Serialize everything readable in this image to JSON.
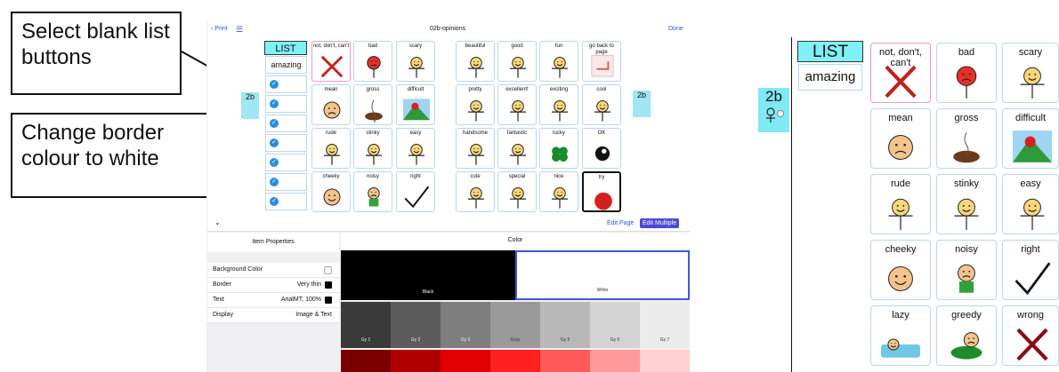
{
  "callouts": {
    "select_blank": "Select blank list buttons",
    "change_border": "Change border colour to white"
  },
  "ipad": {
    "print_label": "Print",
    "title": "02b-opinions",
    "done_label": "Done",
    "list_header": "LIST",
    "list_first": "amazing",
    "side_label": "2b",
    "edit_page": "Edit Page",
    "edit_multiple": "Edit Multiple",
    "item_properties": "Item Properties",
    "color_header": "Color",
    "properties": [
      {
        "key": "Background Color",
        "value": ""
      },
      {
        "key": "Border",
        "value": "Very thin"
      },
      {
        "key": "Text",
        "value": "ArialMT, 100%"
      },
      {
        "key": "Display",
        "value": "Image & Text"
      }
    ],
    "swatches_top": [
      {
        "name": "Black",
        "color": "#000000"
      },
      {
        "name": "White",
        "color": "#ffffff"
      }
    ],
    "swatches_gray": [
      {
        "name": "Gy 1",
        "color": "#3a3a3a"
      },
      {
        "name": "Gy 2",
        "color": "#5c5c5c"
      },
      {
        "name": "Gy 3",
        "color": "#7e7e7e"
      },
      {
        "name": "Gray",
        "color": "#9a9a9a"
      },
      {
        "name": "Gy 5",
        "color": "#b8b8b8"
      },
      {
        "name": "Gy 6",
        "color": "#d4d4d4"
      },
      {
        "name": "Gy 7",
        "color": "#ececec"
      }
    ],
    "swatches_red": [
      "#7a0000",
      "#b00000",
      "#e00000",
      "#ff2020",
      "#ff5a5a",
      "#ff9a9a",
      "#ffd0d0"
    ],
    "cells": [
      "not, don't, can't",
      "bad",
      "scary",
      "beautiful",
      "good",
      "fun",
      "go back to page",
      "mean",
      "gross",
      "difficult",
      "pretty",
      "excellent!",
      "exciting",
      "cool",
      "rude",
      "stinky",
      "easy",
      "handsome",
      "fantastic",
      "lucky",
      "OK",
      "cheeky",
      "noisy",
      "right",
      "cute",
      "special",
      "nice",
      "try"
    ]
  },
  "zoom": {
    "list_header": "LIST",
    "list_first": "amazing",
    "side_label": "2b",
    "cells": [
      "not, don't, can't",
      "bad",
      "scary",
      "mean",
      "gross",
      "difficult",
      "rude",
      "stinky",
      "easy",
      "cheeky",
      "noisy",
      "right",
      "lazy",
      "greedy",
      "wrong"
    ]
  }
}
